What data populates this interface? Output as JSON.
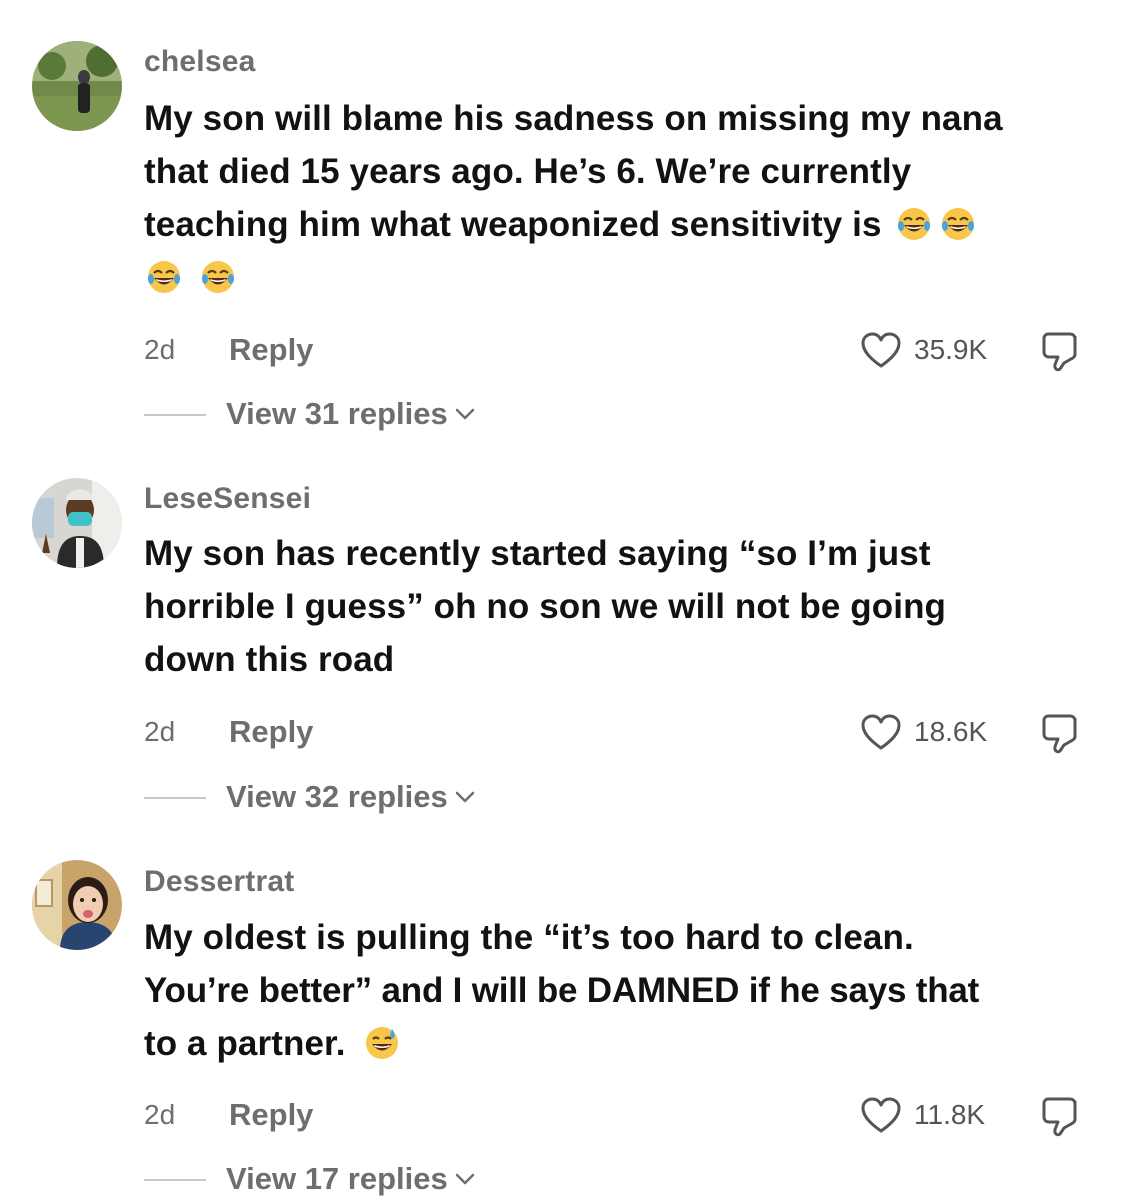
{
  "comments": [
    {
      "username": "chelsea",
      "avatar": "avatar-photo-person-in-garden",
      "text_lines": [
        "My son will blame his sadness on missing my nana",
        "that died 15 years ago. He’s 6. We’re currently",
        "teaching him what weaponized sensitivity is"
      ],
      "emojis": [
        "face-with-tears-of-joy",
        "face-with-tears-of-joy",
        "face-with-tears-of-joy",
        "face-with-tears-of-joy"
      ],
      "time": "2d",
      "reply_label": "Reply",
      "likes": "35.9K",
      "view_replies": "View 31 replies"
    },
    {
      "username": "LeseSensei",
      "avatar": "avatar-photo-person-with-mask",
      "text_lines": [
        "My son has recently started saying “so I’m just",
        "horrible I guess” oh no son we will not be going",
        "down this road"
      ],
      "time": "2d",
      "reply_label": "Reply",
      "likes": "18.6K",
      "view_replies": "View 32 replies"
    },
    {
      "username": "Dessertrat",
      "avatar": "avatar-photo-person-tongue-out",
      "text_lines": [
        "My oldest is pulling the “it’s too hard to clean.",
        "You’re better” and I will be DAMNED if he says that",
        "to a partner."
      ],
      "emojis": [
        "grinning-face-with-sweat"
      ],
      "time": "2d",
      "reply_label": "Reply",
      "likes": "11.8K",
      "view_replies": "View 17 replies"
    }
  ],
  "colors": {
    "text": "#121212",
    "muted": "#6e6e6e",
    "divider": "#c9c9c9"
  },
  "icons": [
    "heart-outline-icon",
    "thumbs-down-outline-icon",
    "chevron-down-icon"
  ]
}
